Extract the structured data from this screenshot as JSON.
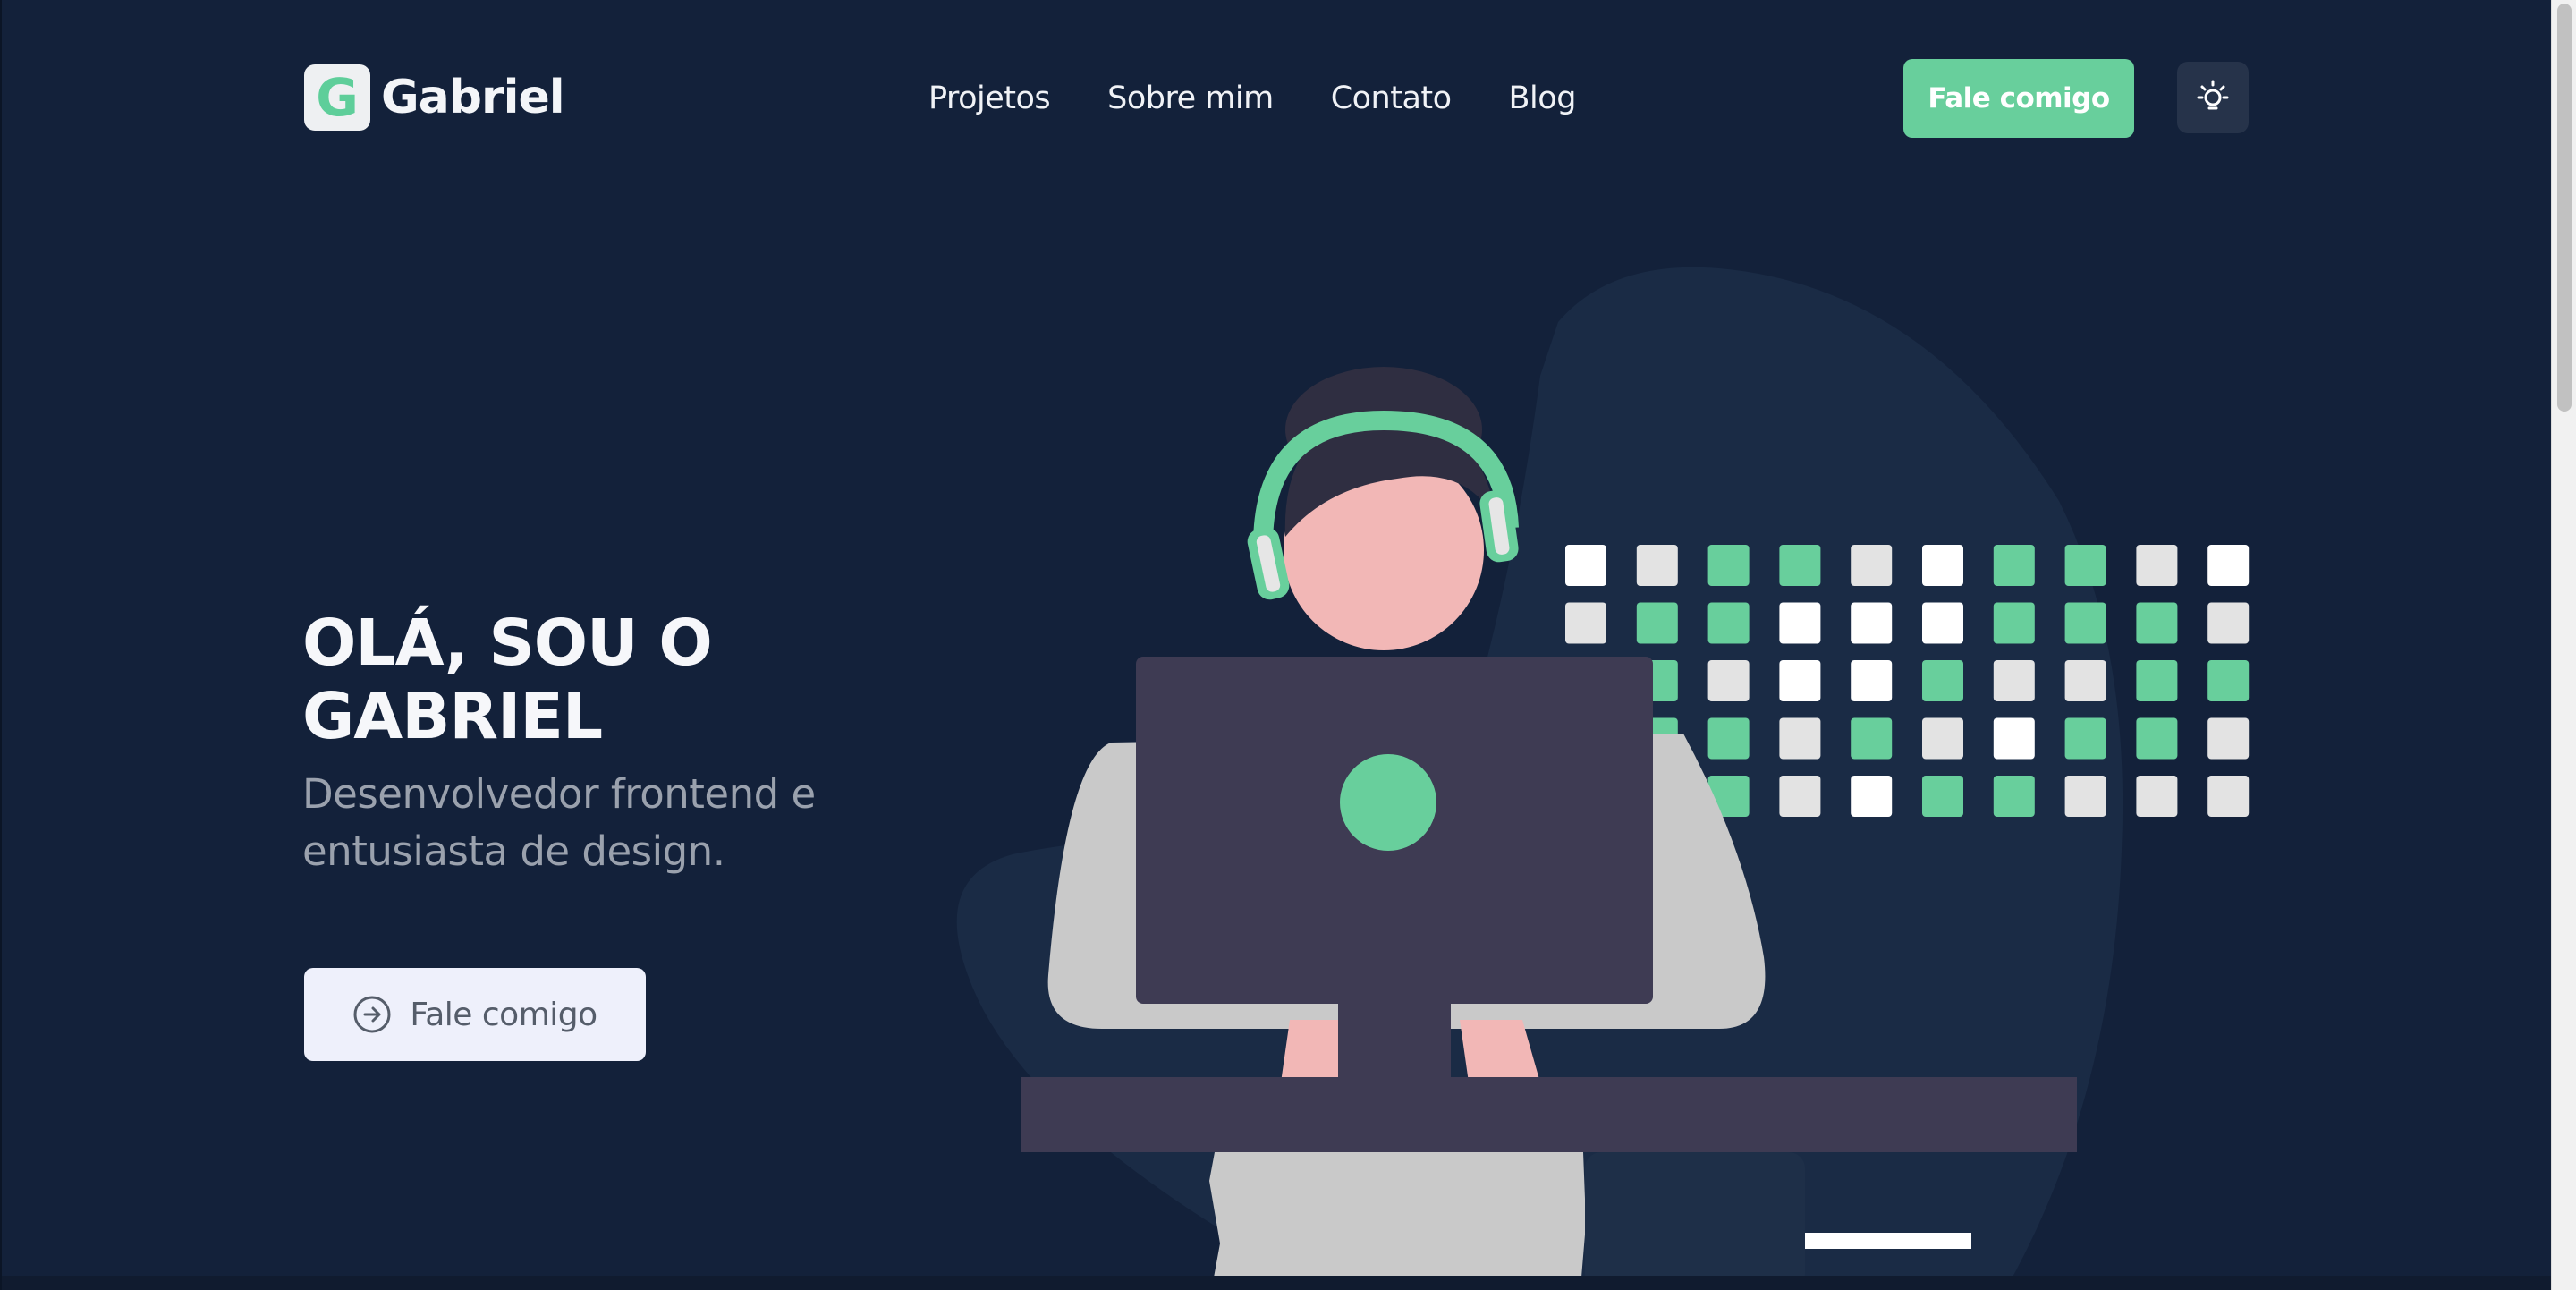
{
  "header": {
    "logo_letter": "G",
    "logo_name": "Gabriel",
    "nav": [
      "Projetos",
      "Sobre mim",
      "Contato",
      "Blog"
    ],
    "cta_label": "Fale comigo",
    "theme_icon": "lightbulb-icon"
  },
  "hero": {
    "title": "OLÁ, SOU O GABRIEL",
    "subtitle": "Desenvolvedor frontend e entusiasta de design.",
    "cta_label": "Fale comigo",
    "cta_icon": "arrow-circle-right-icon"
  },
  "colors": {
    "background": "#13213a",
    "accent": "#68cf9c",
    "blob": "#1a2b45",
    "laptop": "#3e3b53",
    "skin": "#f2b7b6",
    "hoodie": "#c9c9c9"
  }
}
